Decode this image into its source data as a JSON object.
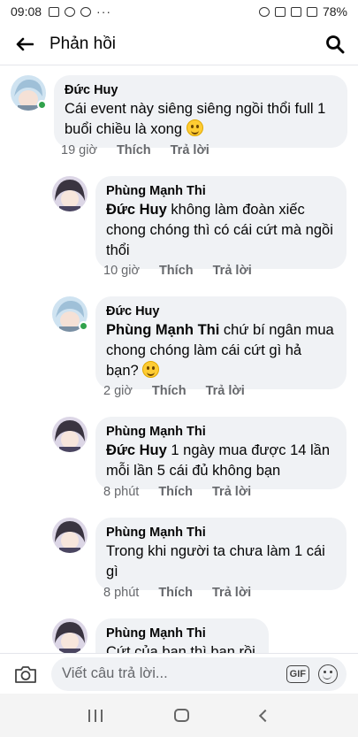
{
  "status_bar": {
    "time": "09:08",
    "more": "···",
    "battery": "78%"
  },
  "header": {
    "title": "Phản hồi"
  },
  "comments": [
    {
      "author": "Đức Huy",
      "tag": "",
      "text": "Cái event này siêng siêng ngồi thổi full 1 buổi chiều là xong",
      "time": "19 giờ",
      "like": "Thích",
      "reply": "Trả lời"
    },
    {
      "author": "Phùng Mạnh Thi",
      "tag": "Đức Huy",
      "text": "không làm đoàn xiếc chong chóng thì có cái cứt mà ngồi thổi",
      "time": "10 giờ",
      "like": "Thích",
      "reply": "Trả lời"
    },
    {
      "author": "Đức Huy",
      "tag": "Phùng Mạnh Thi",
      "text": "chứ bí ngân mua chong chóng làm cái cứt gì hả bạn?",
      "time": "2 giờ",
      "like": "Thích",
      "reply": "Trả lời"
    },
    {
      "author": "Phùng Mạnh Thi",
      "tag": "Đức Huy",
      "text": "1 ngày mua được 14 lần mỗi lần 5 cái đủ không bạn",
      "time": "8 phút",
      "like": "Thích",
      "reply": "Trả lời"
    },
    {
      "author": "Phùng Mạnh Thi",
      "tag": "",
      "text": "Trong khi người ta chưa làm 1 cái gì",
      "time": "8 phút",
      "like": "Thích",
      "reply": "Trả lời"
    },
    {
      "author": "Phùng Mạnh Thi",
      "tag": "",
      "text": "Cứt của bạn thì bạn rồi",
      "time": "",
      "like": "",
      "reply": ""
    }
  ],
  "composer": {
    "placeholder": "Viết câu trả lời...",
    "gif": "GIF"
  },
  "colors": {
    "bubble": "#f0f2f5",
    "online": "#31a24c",
    "meta": "#65676b"
  }
}
